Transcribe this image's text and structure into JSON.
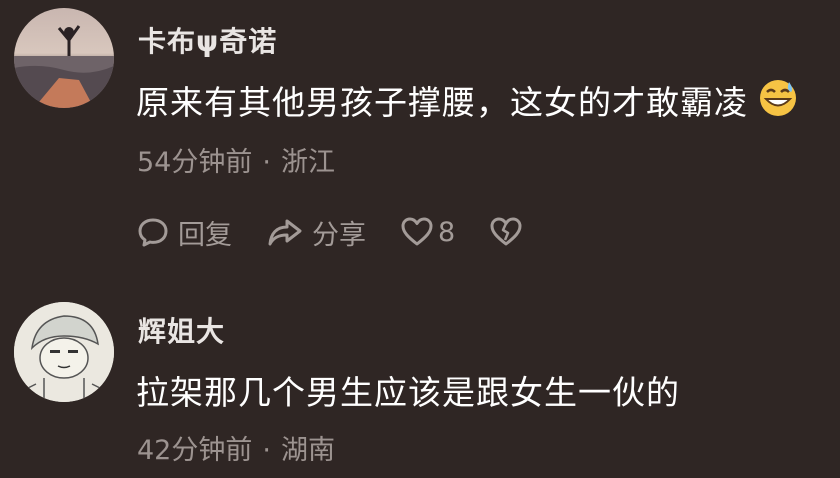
{
  "comments": [
    {
      "username": "卡布ψ奇诺",
      "text": "原来有其他男孩子撑腰，这女的才敢霸凌",
      "emoji": "grinning-sweat-emoji",
      "time": "54分钟前",
      "separator": "·",
      "location": "浙江",
      "actions": {
        "reply_label": "回复",
        "share_label": "分享",
        "like_count": "8"
      }
    },
    {
      "username": "辉姐大",
      "text": "拉架那几个男生应该是跟女生一伙的",
      "time": "42分钟前",
      "separator": "·",
      "location": "湖南"
    }
  ],
  "colors": {
    "background": "#2f2624",
    "text_primary": "#ffffff",
    "text_secondary": "#9c9390",
    "username": "#e9e5e3"
  }
}
